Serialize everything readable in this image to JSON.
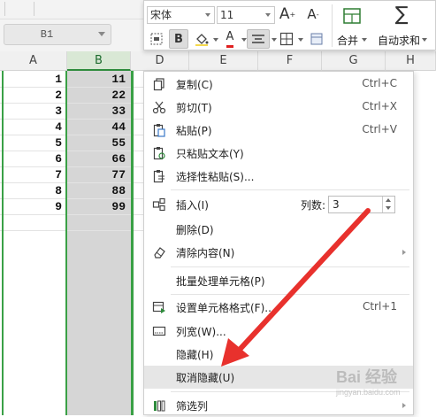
{
  "namebox": {
    "value": "B1"
  },
  "columns": [
    "A",
    "B",
    "D",
    "E",
    "F",
    "G",
    "H"
  ],
  "cells": [
    {
      "a": "1",
      "b": "11"
    },
    {
      "a": "2",
      "b": "22"
    },
    {
      "a": "3",
      "b": "33"
    },
    {
      "a": "4",
      "b": "44"
    },
    {
      "a": "5",
      "b": "55"
    },
    {
      "a": "6",
      "b": "66"
    },
    {
      "a": "7",
      "b": "77"
    },
    {
      "a": "8",
      "b": "88"
    },
    {
      "a": "9",
      "b": "99"
    }
  ],
  "toolbar": {
    "font_name": "宋体",
    "font_size": "11",
    "grow_font": "A",
    "shrink_font": "A",
    "bold": "B",
    "font_color_glyph": "A",
    "merge_label": "合并",
    "autosum_label": "自动求和",
    "sigma": "∑"
  },
  "menu": {
    "items": [
      {
        "label": "复制(C)",
        "shortcut": "Ctrl+C",
        "icon": "copy-icon"
      },
      {
        "label": "剪切(T)",
        "shortcut": "Ctrl+X",
        "icon": "scissors-icon"
      },
      {
        "label": "粘贴(P)",
        "shortcut": "Ctrl+V",
        "icon": "paste-icon"
      },
      {
        "label": "只粘贴文本(Y)",
        "shortcut": "",
        "icon": "paste-text-icon"
      },
      {
        "label": "选择性粘贴(S)...",
        "shortcut": "",
        "icon": "paste-special-icon"
      },
      {
        "label": "插入(I)",
        "shortcut": "",
        "icon": "insert-icon"
      },
      {
        "label": "删除(D)",
        "shortcut": "",
        "icon": ""
      },
      {
        "label": "清除内容(N)",
        "shortcut": "",
        "icon": "eraser-icon"
      },
      {
        "label": "批量处理单元格(P)",
        "shortcut": "",
        "icon": ""
      },
      {
        "label": "设置单元格格式(F)...",
        "shortcut": "Ctrl+1",
        "icon": "format-cells-icon"
      },
      {
        "label": "列宽(W)...",
        "shortcut": "",
        "icon": "column-width-icon"
      },
      {
        "label": "隐藏(H)",
        "shortcut": "",
        "icon": ""
      },
      {
        "label": "取消隐藏(U)",
        "shortcut": "",
        "icon": ""
      },
      {
        "label": "筛选列",
        "shortcut": "",
        "icon": "filter-column-icon"
      }
    ],
    "insert_count_label": "列数:",
    "insert_count_value": "3"
  },
  "watermark": {
    "text": "Bai 经验",
    "url": "jingyan.baidu.com"
  },
  "colors": {
    "selection_green": "#3aa046",
    "arrow_red": "#e8312d",
    "selected_fill": "#d6d6d6"
  }
}
